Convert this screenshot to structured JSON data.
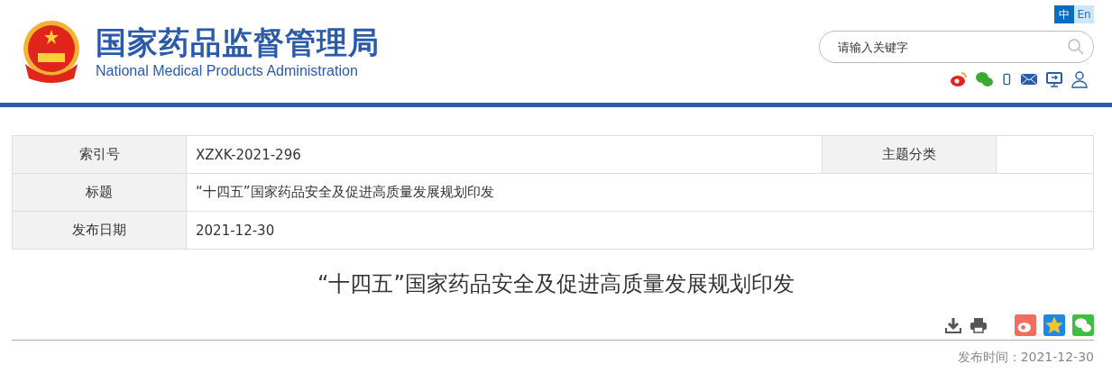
{
  "header": {
    "title": "国家药品监督管理局",
    "subtitle": "National Medical Products Administration",
    "languages": [
      {
        "label": "中",
        "selected": true
      },
      {
        "label": "En",
        "selected": false
      }
    ],
    "search": {
      "placeholder": "请输入关键字"
    }
  },
  "info_table": {
    "rows": [
      {
        "cells": [
          {
            "kind": "label",
            "text": "索引号"
          },
          {
            "kind": "value",
            "text": "XZXK-2021-296"
          },
          {
            "kind": "label",
            "text": "主题分类"
          },
          {
            "kind": "value"
          }
        ]
      },
      {
        "cells": [
          {
            "kind": "label",
            "text": "标题"
          },
          {
            "kind": "value",
            "text": "“十四五”国家药品安全及促进高质量发展规划印发",
            "colspan": 3
          }
        ]
      },
      {
        "cells": [
          {
            "kind": "label",
            "text": "发布日期"
          },
          {
            "kind": "value",
            "text": "2021-12-30",
            "colspan": 3
          }
        ]
      }
    ]
  },
  "article": {
    "title": "“十四五”国家药品安全及促进高质量发展规划印发",
    "publish_time": "发布时间：2021-12-30"
  }
}
